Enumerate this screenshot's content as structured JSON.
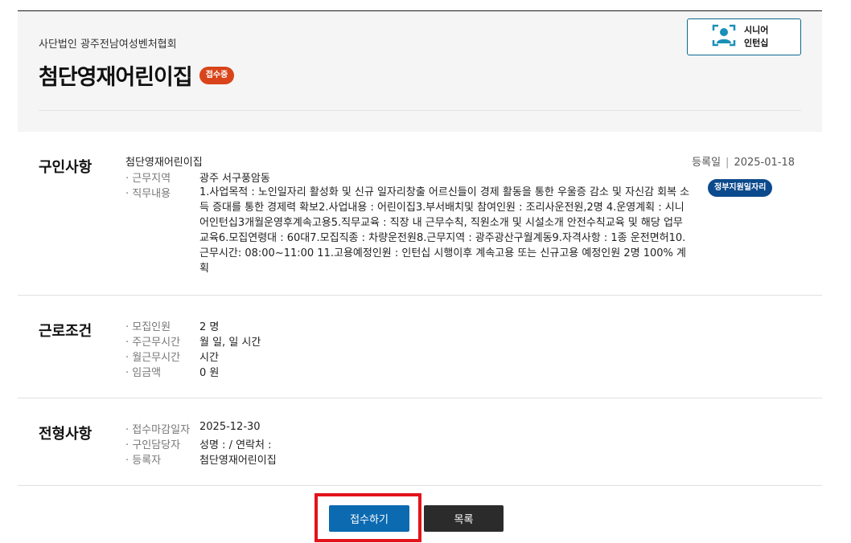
{
  "header": {
    "org": "사단법인 광주전남여성벤처협회",
    "title": "첨단영재어린이집",
    "status": "접수중",
    "senior_line1": "시니어",
    "senior_line2": "인턴십",
    "senior_icon": "person-frame-icon"
  },
  "job": {
    "section_title": "구인사항",
    "company": "첨단영재어린이집",
    "location_label": "· 근무지역",
    "location": "광주 서구풍암동",
    "duties_label": "· 직무내용",
    "duties": "1.사업목적 :  노인일자리 활성화 및 신규 일자리창출 어르신들이 경제 활동을 통한 우울증 감소 및 자신감 회복 소득 증대를 통한 경제력 확보2.사업내용 : 어린이집3.부서배치및 참여인원 : 조리사운전원,2명 4.운영계획 : 시니어인턴십3개월운영후계속고용5.직무교육 :  직장 내 근무수칙, 직원소개 및 시설소개 안전수칙교육 및 해당 업무 교육6.모집연령대 : 60대7.모집직종 : 차량운전원8.근무지역 :  광주광산구월계동9.자격사항 : 1종 운전면허10.근무시간: 08:00~11:00 11.고용예정인원 : 인턴십 시행이후 계속고용 또는 신규고용 예정인원 2명 100% 계획",
    "reg_label": "등록일",
    "reg_sep": "|",
    "reg_date": "2025-01-18",
    "badge": "정부지원일자리"
  },
  "conditions": {
    "section_title": "근로조건",
    "rows": [
      {
        "label": "· 모집인원",
        "value": "2 명"
      },
      {
        "label": "· 주근무시간",
        "value": "월 일, 일 시간"
      },
      {
        "label": "· 월근무시간",
        "value": "시간"
      },
      {
        "label": "· 임금액",
        "value": "0 원"
      }
    ]
  },
  "selection": {
    "section_title": "전형사항",
    "rows": [
      {
        "label": "· 접수마감일자",
        "value": "2025-12-30"
      },
      {
        "label": "· 구인담당자",
        "value": "성명 : / 연락처 :"
      },
      {
        "label": "· 등록자",
        "value": "첨단영재어린이집"
      }
    ]
  },
  "actions": {
    "apply": "접수하기",
    "list": "목록"
  },
  "colors": {
    "status_badge": "#d9441a",
    "gov_badge": "#0b4a8c",
    "apply_button": "#0c6ab0",
    "list_button": "#2b2b2b",
    "highlight": "#e3131b"
  }
}
